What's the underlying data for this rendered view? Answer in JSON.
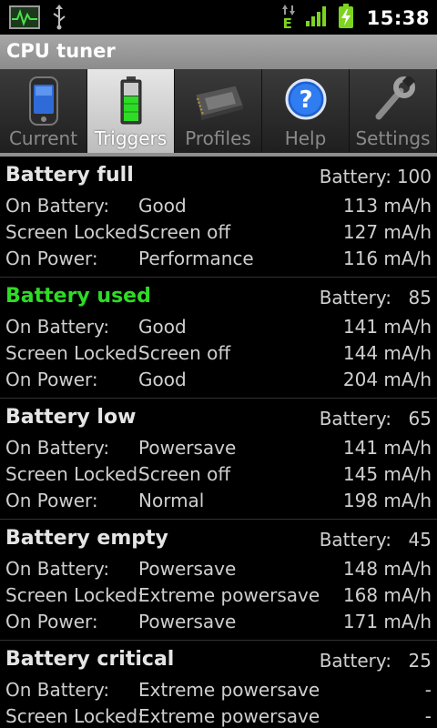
{
  "status_bar": {
    "icons": [
      "activity-monitor-icon",
      "usb-icon",
      "edge-data-icon",
      "signal-icon",
      "battery-charging-icon"
    ],
    "edge_letter": "E",
    "time": "15:38"
  },
  "app": {
    "title": "CPU tuner"
  },
  "tabs": [
    {
      "label": "Current",
      "icon": "phone-icon",
      "active": false
    },
    {
      "label": "Triggers",
      "icon": "battery-icon",
      "active": true
    },
    {
      "label": "Profiles",
      "icon": "chip-icon",
      "active": false
    },
    {
      "label": "Help",
      "icon": "help-icon",
      "active": false
    },
    {
      "label": "Settings",
      "icon": "wrench-icon",
      "active": false
    }
  ],
  "triggers": [
    {
      "name": "Battery full",
      "active": false,
      "battery_label": "Battery:",
      "battery_value": "100",
      "rows": [
        {
          "label": "On Battery:",
          "profile": "Good",
          "rate": "113 mA/h"
        },
        {
          "label": "Screen Locked:",
          "profile": "Screen off",
          "rate": "127 mA/h"
        },
        {
          "label": "On Power:",
          "profile": "Performance",
          "rate": "116 mA/h"
        }
      ]
    },
    {
      "name": "Battery used",
      "active": true,
      "battery_label": "Battery:",
      "battery_value": "85",
      "rows": [
        {
          "label": "On Battery:",
          "profile": "Good",
          "rate": "141 mA/h"
        },
        {
          "label": "Screen Locked:",
          "profile": "Screen off",
          "rate": "144 mA/h"
        },
        {
          "label": "On Power:",
          "profile": "Good",
          "rate": "204 mA/h"
        }
      ]
    },
    {
      "name": "Battery low",
      "active": false,
      "battery_label": "Battery:",
      "battery_value": "65",
      "rows": [
        {
          "label": "On Battery:",
          "profile": "Powersave",
          "rate": "141 mA/h"
        },
        {
          "label": "Screen Locked:",
          "profile": "Screen off",
          "rate": "145 mA/h"
        },
        {
          "label": "On Power:",
          "profile": "Normal",
          "rate": "198 mA/h"
        }
      ]
    },
    {
      "name": "Battery empty",
      "active": false,
      "battery_label": "Battery:",
      "battery_value": "45",
      "rows": [
        {
          "label": "On Battery:",
          "profile": "Powersave",
          "rate": "148 mA/h"
        },
        {
          "label": "Screen Locked:",
          "profile": "Extreme powersave",
          "rate": "168 mA/h"
        },
        {
          "label": "On Power:",
          "profile": "Powersave",
          "rate": "171 mA/h"
        }
      ]
    },
    {
      "name": "Battery critical",
      "active": false,
      "battery_label": "Battery:",
      "battery_value": "25",
      "rows": [
        {
          "label": "On Battery:",
          "profile": "Extreme powersave",
          "rate": "-"
        },
        {
          "label": "Screen Locked:",
          "profile": "Extreme powersave",
          "rate": "-"
        }
      ]
    }
  ],
  "colors": {
    "active_trigger": "#2ddc25",
    "title_bar": "#9a9a9a",
    "background": "#000000"
  }
}
